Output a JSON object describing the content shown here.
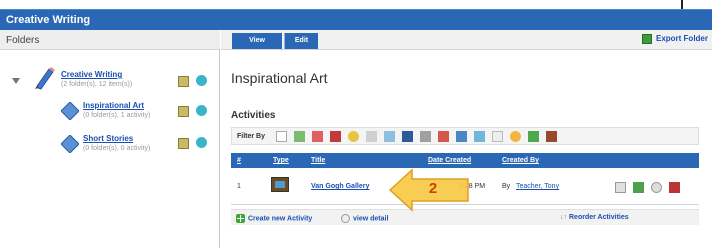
{
  "header": {
    "title": "Creative Writing"
  },
  "left_panel": {
    "heading": "Folders",
    "root": {
      "name": "Creative Writing",
      "meta": "(2 folder(s), 12 item(s))"
    },
    "children": [
      {
        "name": "Inspirational Art",
        "meta": "(0 folder(s), 1 activity)"
      },
      {
        "name": "Short Stories",
        "meta": "(0 folder(s), 0 activity)"
      }
    ]
  },
  "tabs": {
    "view": "View",
    "edit": "Edit"
  },
  "toolbar": {
    "export_label": "Export Folder"
  },
  "main": {
    "title": "Inspirational Art",
    "section_title": "Activities",
    "filter_label": "Filter By"
  },
  "table": {
    "headers": {
      "num": "#",
      "type": "Type",
      "title": "Title",
      "date": "Date Created",
      "created_by": "Created By"
    },
    "row": {
      "num": "1",
      "title": "Van Gogh Gallery",
      "date": "2:28 PM",
      "by_prefix": "By",
      "author": "Teacher, Tony"
    }
  },
  "footer": {
    "create_label": "Create new Activity",
    "view_label": "view detail",
    "reorder_label": "Reorder Activities",
    "sort_glyph": "↓↑"
  },
  "callout": {
    "number": "2"
  },
  "colors": {
    "brand": "#2a68b5",
    "link": "#1a4fb0",
    "callout": "#f6c945"
  }
}
